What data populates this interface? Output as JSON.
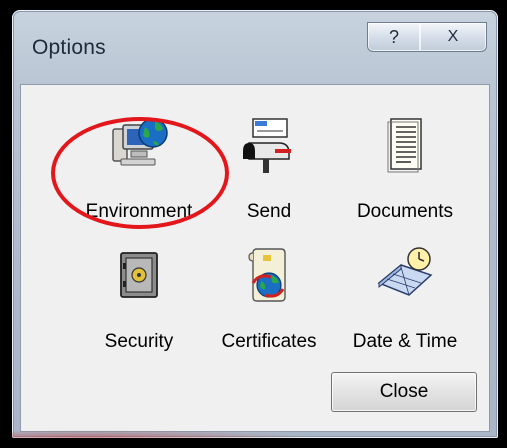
{
  "window": {
    "title": "Options",
    "help_glyph": "?",
    "close_glyph": "X"
  },
  "items": [
    {
      "label": "Environment",
      "icon": "computer-globe-icon"
    },
    {
      "label": "Send",
      "icon": "mailbox-icon"
    },
    {
      "label": "Documents",
      "icon": "document-icon"
    },
    {
      "label": "Security",
      "icon": "safe-icon"
    },
    {
      "label": "Certificates",
      "icon": "certificate-globe-icon"
    },
    {
      "label": "Date & Time",
      "icon": "calendar-clock-icon"
    }
  ],
  "buttons": {
    "close_label": "Close"
  },
  "colors": {
    "highlight": "#e3161b",
    "client_bg": "#f0f0f0"
  }
}
